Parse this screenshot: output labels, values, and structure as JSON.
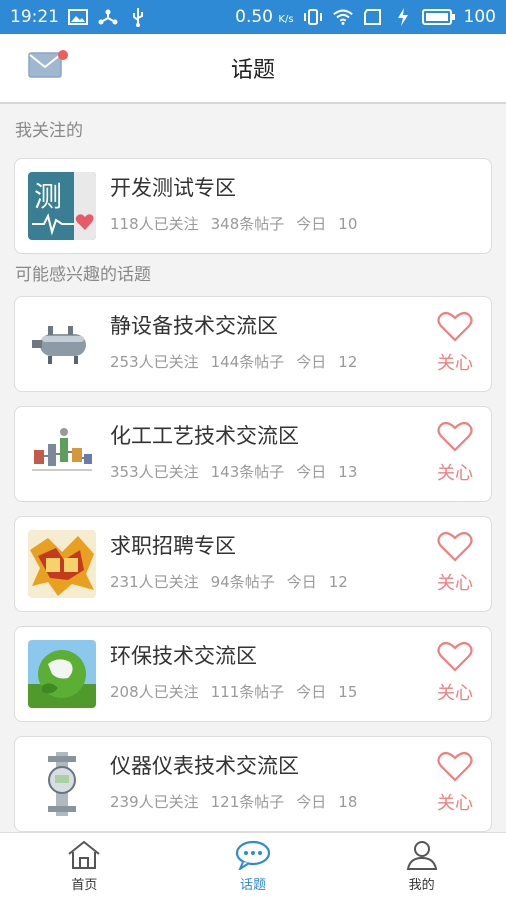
{
  "status": {
    "time": "19:21",
    "speed": "0.50",
    "speed_unit": "K/s",
    "battery": "100"
  },
  "header": {
    "title": "话题"
  },
  "sections": {
    "followed_title": "我关注的",
    "suggested_title": "可能感兴趣的话题"
  },
  "followed": [
    {
      "name": "开发测试专区",
      "followers": "118人已关注",
      "posts": "348条帖子",
      "today_label": "今日",
      "today": "10",
      "icon": "test-logo-icon"
    }
  ],
  "suggested": [
    {
      "name": "静设备技术交流区",
      "followers": "253人已关注",
      "posts": "144条帖子",
      "today_label": "今日",
      "today": "12",
      "follow_label": "关心",
      "icon": "pressure-vessel-image"
    },
    {
      "name": "化工工艺技术交流区",
      "followers": "353人已关注",
      "posts": "143条帖子",
      "today_label": "今日",
      "today": "13",
      "follow_label": "关心",
      "icon": "process-flow-image"
    },
    {
      "name": "求职招聘专区",
      "followers": "231人已关注",
      "posts": "94条帖子",
      "today_label": "今日",
      "today": "12",
      "follow_label": "关心",
      "icon": "recruitment-image"
    },
    {
      "name": "环保技术交流区",
      "followers": "208人已关注",
      "posts": "111条帖子",
      "today_label": "今日",
      "today": "15",
      "follow_label": "关心",
      "icon": "green-earth-image"
    },
    {
      "name": "仪器仪表技术交流区",
      "followers": "239人已关注",
      "posts": "121条帖子",
      "today_label": "今日",
      "today": "18",
      "follow_label": "关心",
      "icon": "flowmeter-image"
    }
  ],
  "tabs": [
    {
      "label": "首页",
      "icon": "home-icon"
    },
    {
      "label": "话题",
      "icon": "chat-bubble-icon"
    },
    {
      "label": "我的",
      "icon": "user-icon"
    }
  ],
  "colors": {
    "primary": "#2f8ad6",
    "follow": "#f08080",
    "notify_dot": "#f25b5b"
  }
}
